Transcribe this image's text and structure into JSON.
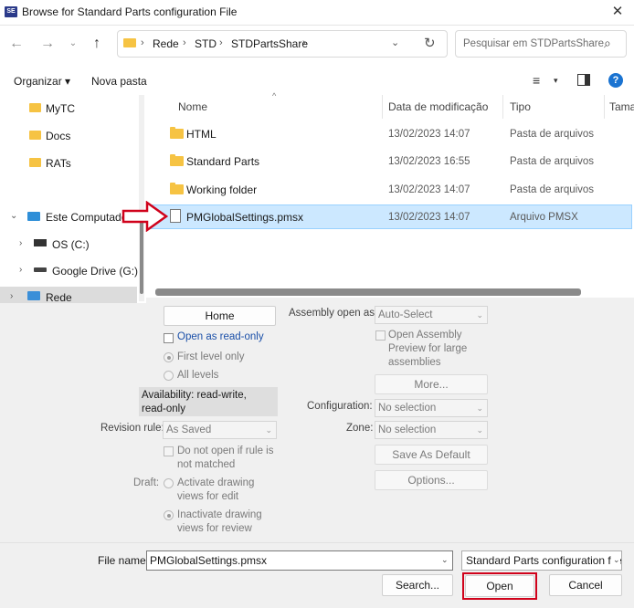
{
  "window": {
    "title": "Browse for Standard Parts configuration File",
    "app_icon_text": "SE",
    "close_glyph": "✕"
  },
  "address": {
    "breadcrumbs": [
      "Rede",
      "STD",
      "STDPartsShare"
    ],
    "search_placeholder": "Pesquisar em STDPartsShare"
  },
  "toolbar": {
    "organize_label": "Organizar ▾",
    "new_folder_label": "Nova pasta"
  },
  "nav": {
    "items": [
      {
        "label": "MyTC"
      },
      {
        "label": "Docs"
      },
      {
        "label": "RATs"
      },
      {
        "label": "Este Computador"
      },
      {
        "label": "OS (C:)"
      },
      {
        "label": "Google Drive (G:)"
      },
      {
        "label": "Rede"
      }
    ]
  },
  "files": {
    "columns": [
      "Nome",
      "Data de modificação",
      "Tipo",
      "Tama"
    ],
    "rows": [
      {
        "name": "HTML",
        "date": "13/02/2023 14:07",
        "type": "Pasta de arquivos",
        "icon": "folder-icon"
      },
      {
        "name": "Standard Parts",
        "date": "13/02/2023 16:55",
        "type": "Pasta de arquivos",
        "icon": "folder-icon"
      },
      {
        "name": "Working folder",
        "date": "13/02/2023 14:07",
        "type": "Pasta de arquivos",
        "icon": "folder-icon"
      },
      {
        "name": "PMGlobalSettings.pmsx",
        "date": "13/02/2023 14:07",
        "type": "Arquivo PMSX",
        "icon": "document-icon",
        "selected": true
      }
    ]
  },
  "options": {
    "home_label": "Home",
    "open_readonly_label": "Open as read-only",
    "first_level_label": "First level only",
    "all_levels_label": "All levels",
    "availability_line1": "Availability: read-write,",
    "availability_line2": "read-only",
    "revision_rule_label": "Revision rule:",
    "revision_rule_value": "As Saved",
    "do_not_open_line1": "Do not open if rule is",
    "do_not_open_line2": "not matched",
    "draft_label": "Draft:",
    "activate_line1": "Activate drawing",
    "activate_line2": "views for edit",
    "inactivate_line1": "Inactivate drawing",
    "inactivate_line2": "views for review",
    "assembly_open_label": "Assembly open as:",
    "assembly_open_value": "Auto-Select",
    "open_preview_line1": "Open Assembly",
    "open_preview_line2": "Preview for large",
    "open_preview_line3": "assemblies",
    "more_label": "More...",
    "configuration_label": "Configuration:",
    "configuration_value": "No selection",
    "zone_label": "Zone:",
    "zone_value": "No selection",
    "save_default_label": "Save As Default",
    "options_label": "Options..."
  },
  "bottom": {
    "file_name_label": "File name:",
    "file_name_value": "PMGlobalSettings.pmsx",
    "file_type_value": "Standard Parts configuration file",
    "search_label": "Search...",
    "open_label": "Open",
    "cancel_label": "Cancel"
  },
  "colors": {
    "selection": "#cce8ff",
    "highlight_red": "#d0021b",
    "folder": "#f6c343",
    "accent": "#1a73d1"
  }
}
